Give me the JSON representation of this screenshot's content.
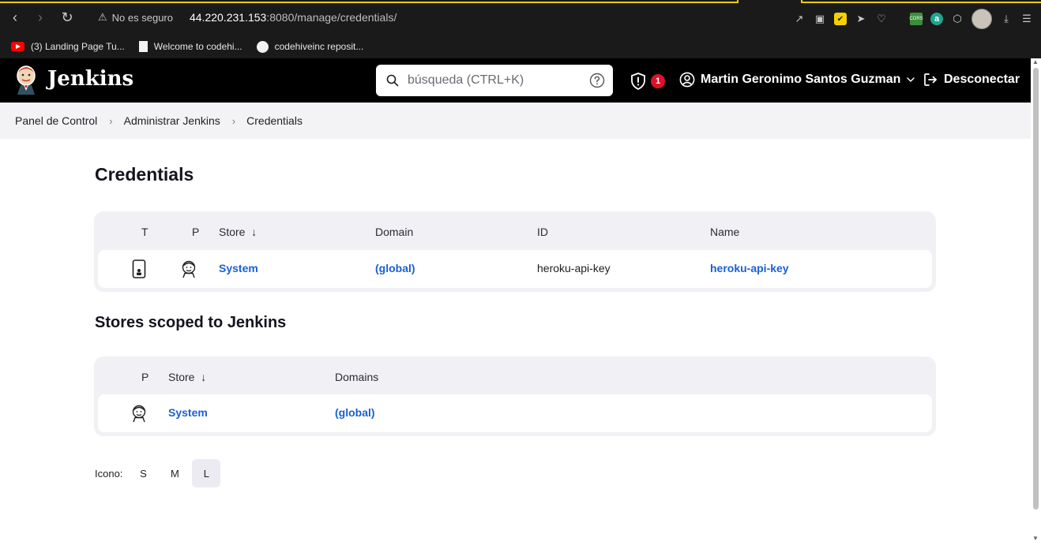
{
  "browser": {
    "security_warning": "No es seguro",
    "url_host": "44.220.231.153",
    "url_path": ":8080/manage/credentials/",
    "bookmarks": [
      {
        "label": "(3) Landing Page Tu..."
      },
      {
        "label": "Welcome to codehi..."
      },
      {
        "label": "codehiveinc reposit..."
      }
    ],
    "ext_cors_label": "CORS",
    "ext_a_label": "a"
  },
  "header": {
    "logo_text": "Jenkins",
    "search_placeholder": "búsqueda (CTRL+K)",
    "alert_count": "1",
    "user_name": "Martin Geronimo Santos Guzman",
    "logout_label": "Desconectar"
  },
  "breadcrumb": {
    "items": [
      "Panel de Control",
      "Administrar Jenkins",
      "Credentials"
    ]
  },
  "main": {
    "title": "Credentials",
    "credentials_table": {
      "headers": {
        "t": "T",
        "p": "P",
        "store": "Store  ↓",
        "domain": "Domain",
        "id": "ID",
        "name": "Name"
      },
      "rows": [
        {
          "store": "System",
          "domain": "(global)",
          "id": "heroku-api-key",
          "name": "heroku-api-key"
        }
      ]
    },
    "stores_title": "Stores scoped to Jenkins",
    "stores_table": {
      "headers": {
        "p": "P",
        "store": "Store  ↓",
        "domains": "Domains"
      },
      "rows": [
        {
          "store": "System",
          "domains": "(global)"
        }
      ]
    },
    "icon_size": {
      "label": "Icono:",
      "options": [
        "S",
        "M",
        "L"
      ],
      "selected": "L"
    }
  }
}
